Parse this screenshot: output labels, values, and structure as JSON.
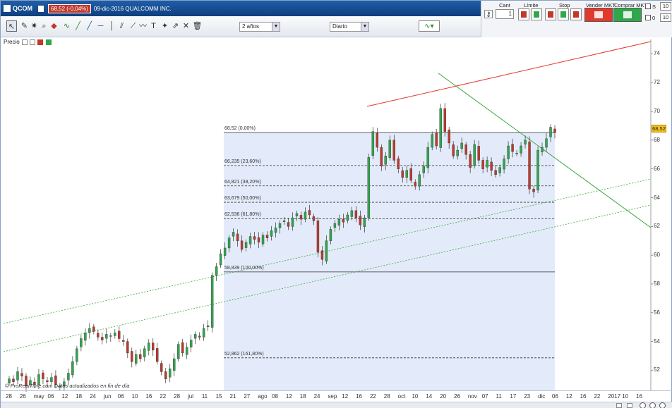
{
  "title_bar": {
    "ticker": "QCOM",
    "price_change": "68,52 (-0,04%)",
    "company": "09-dic-2016 QUALCOMM INC."
  },
  "toolbar": {
    "period_select": "2 años",
    "interval_select": "Diario"
  },
  "trade_panel": {
    "qty_label": "Cant",
    "qty_value": "1",
    "limit_label": "Límite",
    "stop_label": "Stop",
    "sell_label": "Vender MKT",
    "buy_label": "Comprar MKT",
    "spin1": "10",
    "spin2": "10",
    "chk1_label": "S",
    "chk2_label": "0"
  },
  "panel_label": "Precio",
  "watermark": "© ProRealTime.com  Datos actualizados en fin de día",
  "last_price": "68,52",
  "chart_data": {
    "type": "candlestick",
    "y_ticks": [
      "74",
      "72",
      "70",
      "68",
      "66",
      "64",
      "62",
      "60",
      "58",
      "56",
      "54",
      "52"
    ],
    "x_ticks": [
      "28",
      "26",
      "may",
      "06",
      "12",
      "18",
      "24",
      "jun",
      "06",
      "10",
      "16",
      "22",
      "28",
      "jul",
      "11",
      "15",
      "21",
      "27",
      "ago",
      "08",
      "12",
      "18",
      "24",
      "sep",
      "12",
      "16",
      "22",
      "28",
      "oct",
      "10",
      "14",
      "20",
      "26",
      "nov",
      "07",
      "11",
      "17",
      "23",
      "dic",
      "06",
      "12",
      "16",
      "22",
      "2017",
      "10",
      "16"
    ],
    "ylim": [
      50.6,
      75
    ],
    "fibonacci": [
      {
        "label": "68,52 (0,00%)",
        "value": 68.52
      },
      {
        "label": "66,235 (23,60%)",
        "value": 66.235
      },
      {
        "label": "64,821 (38,20%)",
        "value": 64.821
      },
      {
        "label": "63,679 (50,00%)",
        "value": 63.679
      },
      {
        "label": "62,536 (61,80%)",
        "value": 62.536
      },
      {
        "label": "58,839 (100,00%)",
        "value": 58.839
      },
      {
        "label": "52,862 (161,80%)",
        "value": 52.862
      }
    ],
    "closes": [
      51.4,
      51.2,
      51.9,
      51.6,
      50.9,
      51.3,
      51.0,
      51.7,
      51.4,
      51.2,
      51.5,
      51.0,
      50.9,
      51.2,
      51.8,
      52.6,
      53.5,
      54.2,
      54.6,
      54.9,
      54.7,
      54.3,
      54.1,
      54.5,
      54.4,
      54.6,
      54.2,
      54.0,
      53.2,
      52.6,
      53.1,
      52.8,
      53.5,
      53.9,
      53.4,
      52.6,
      51.9,
      51.4,
      52.1,
      52.8,
      53.8,
      53.2,
      53.6,
      54.1,
      54.5,
      54.3,
      54.9,
      55.1,
      58.6,
      59.2,
      60.1,
      60.5,
      61.2,
      61.6,
      61.0,
      60.4,
      60.9,
      61.3,
      61.1,
      60.9,
      61.4,
      61.2,
      61.7,
      61.9,
      62.2,
      62.4,
      62.0,
      62.6,
      62.9,
      62.5,
      63.0,
      62.8,
      62.4,
      60.2,
      59.7,
      61.0,
      61.8,
      62.2,
      62.5,
      62.3,
      62.8,
      63.1,
      62.6,
      62.1,
      62.6,
      66.8,
      68.6,
      67.5,
      66.2,
      66.9,
      68.0,
      66.6,
      66.0,
      65.4,
      65.9,
      65.2,
      64.8,
      65.6,
      66.2,
      67.5,
      68.4,
      67.6,
      70.2,
      68.6,
      67.8,
      66.9,
      67.3,
      67.8,
      67.0,
      66.1,
      67.7,
      66.6,
      66.0,
      66.6,
      65.9,
      65.6,
      66.1,
      66.7,
      67.6,
      67.2,
      67.1,
      67.6,
      68.0,
      64.6,
      64.4,
      67.3,
      67.5,
      68.1,
      68.9,
      68.52
    ]
  }
}
